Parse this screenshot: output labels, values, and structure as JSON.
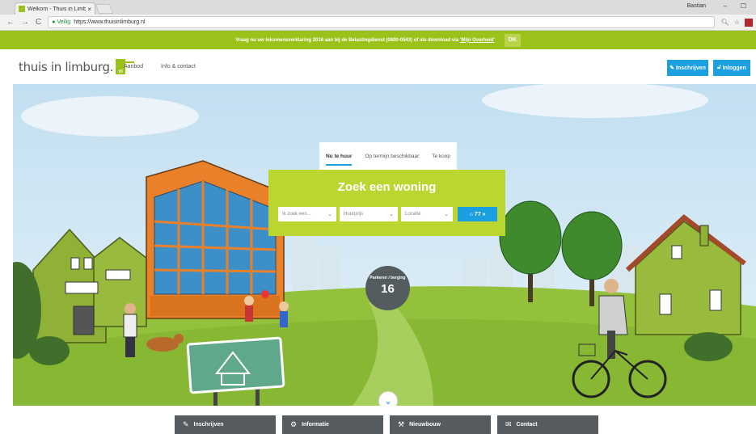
{
  "browser": {
    "tab_title": "Welkom - Thuis in Limb",
    "tab_close": "×",
    "user": "Bastian",
    "win_min": "–",
    "win_max": "☐",
    "secure_label": "Veilig",
    "url": "https://www.thuisinlimburg.nl"
  },
  "notice": {
    "text": "Vraag nu uw inkomensverklaring 2016 aan bij de Belastingdienst (0800-0543) of als download via",
    "link": "'Mijn Overheid'",
    "ok": "OK"
  },
  "header": {
    "logo_text": "thuis in limburg.",
    "logo_tld": "nl",
    "nav": [
      "Aanbod",
      "Info & contact"
    ],
    "register": "Inschrijven",
    "login": "Inloggen"
  },
  "search": {
    "tabs": [
      "Nu te huur",
      "Op termijn beschikbaar",
      "Te koop"
    ],
    "title": "Zoek een woning",
    "select1": "Ik zoek een...",
    "select2": "Huurprijs",
    "select3": "Locatie",
    "button": "77 »"
  },
  "badge": {
    "label": "Parkeren / berging",
    "count": "16"
  },
  "bottom_nav": [
    "Inschrijven",
    "Informatie",
    "Nieuwbouw",
    "Contact"
  ],
  "colors": {
    "brand_green": "#9bc21b",
    "search_green": "#bcd631",
    "accent_blue": "#1a9fe1",
    "dark_grey": "#555b5e"
  }
}
